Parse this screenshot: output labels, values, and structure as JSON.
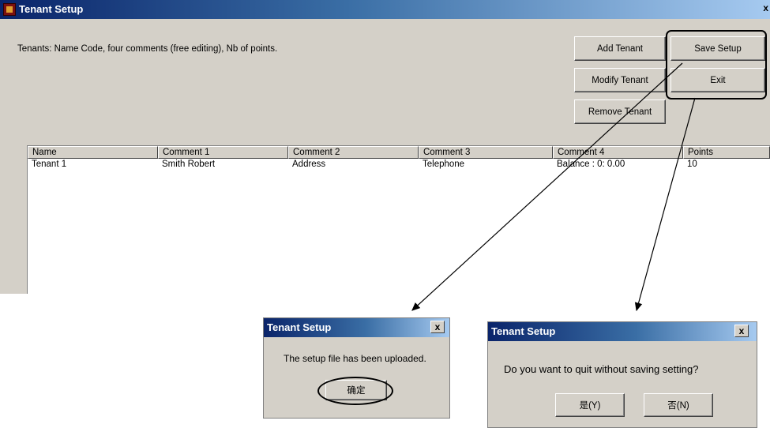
{
  "main": {
    "title": "Tenant Setup",
    "close": "x",
    "description": "Tenants: Name Code, four comments (free editing), Nb of points.",
    "buttons": {
      "add": "Add Tenant",
      "save": "Save Setup",
      "modify": "Modify Tenant",
      "exit": "Exit",
      "remove": "Remove Tenant"
    },
    "columns": [
      "Name",
      "Comment 1",
      "Comment 2",
      "Comment 3",
      "Comment 4",
      "Points"
    ],
    "rows": [
      [
        "Tenant 1",
        "Smith Robert",
        "Address",
        "Telephone",
        "Balance : 0: 0.00",
        "10"
      ]
    ]
  },
  "dialog_upload": {
    "title": "Tenant Setup",
    "close": "x",
    "message": "The setup file has been uploaded.",
    "ok": "确定"
  },
  "dialog_quit": {
    "title": "Tenant Setup",
    "close": "x",
    "message": "Do you want to quit without saving setting?",
    "yes": "是(Y)",
    "no": "否(N)"
  }
}
